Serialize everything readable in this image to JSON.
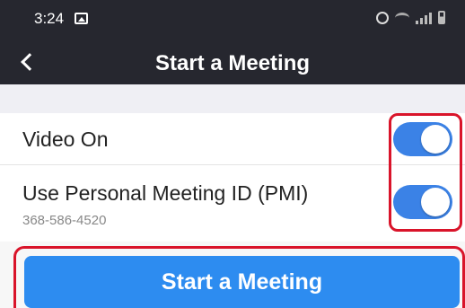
{
  "status_bar": {
    "time": "3:24"
  },
  "nav": {
    "title": "Start a Meeting"
  },
  "settings": {
    "video_on": {
      "label": "Video On",
      "enabled": true
    },
    "pmi": {
      "label": "Use Personal Meeting ID (PMI)",
      "meeting_id": "368-586-4520",
      "enabled": true
    }
  },
  "actions": {
    "start_label": "Start a Meeting"
  },
  "colors": {
    "header": "#26272f",
    "toggle_on": "#3b82e6",
    "primary_button": "#2d8cf0",
    "highlight": "#d9142a"
  }
}
